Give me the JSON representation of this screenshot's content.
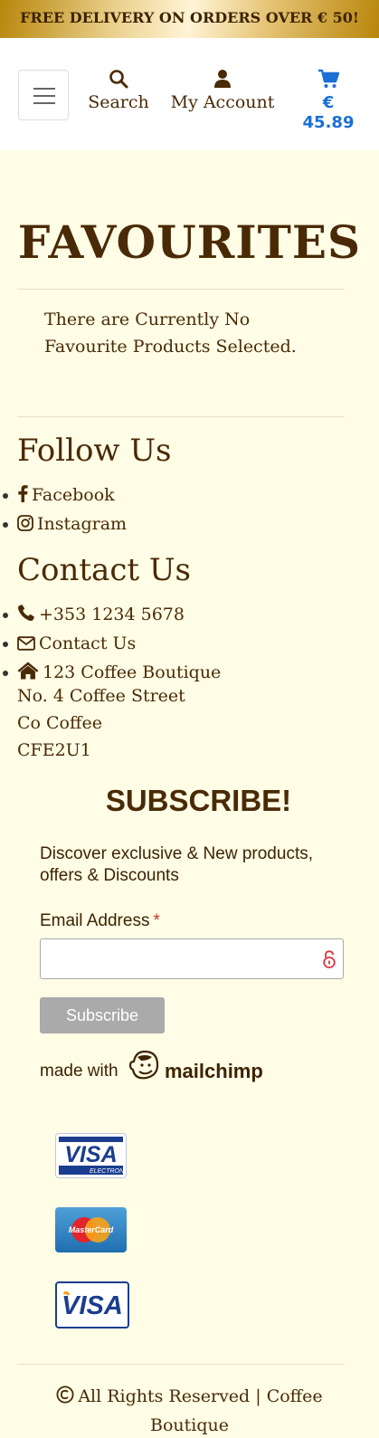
{
  "banner": {
    "text": "FREE DELIVERY ON ORDERS OVER € 50!"
  },
  "header": {
    "menu_icon": "hamburger-menu-icon",
    "search": {
      "icon": "search-icon",
      "label": "Search"
    },
    "account": {
      "icon": "user-icon",
      "label": "My Account"
    },
    "cart": {
      "icon": "shopping-cart-icon",
      "total": "€ 45.89",
      "color": "#1b6fd6"
    }
  },
  "main": {
    "title": "FAVOURITES",
    "empty_message": "There are Currently No Favourite Products Selected."
  },
  "follow": {
    "heading": "Follow Us",
    "items": [
      {
        "icon": "facebook-icon",
        "label": "Facebook"
      },
      {
        "icon": "instagram-icon",
        "label": "Instagram"
      }
    ]
  },
  "contact": {
    "heading": "Contact Us",
    "items": [
      {
        "icon": "phone-icon",
        "label": "+353 1234 5678"
      },
      {
        "icon": "envelope-icon",
        "label": "Contact Us"
      },
      {
        "icon": "home-icon",
        "label": "123 Coffee Boutique"
      }
    ],
    "address_lines": [
      "No. 4 Coffee Street",
      "Co Coffee",
      "CFE2U1"
    ]
  },
  "subscribe": {
    "title": "SUBSCRIBE!",
    "text": "Discover exclusive & New products, offers & Discounts",
    "email_label": "Email Address",
    "required_marker": "*",
    "email_value": "",
    "button_label": "Subscribe",
    "made_with": "made with",
    "brand": "mailchimp"
  },
  "payments": [
    {
      "icon": "visa-electron-card-icon",
      "label": "VISA",
      "sub": "ELECTRON"
    },
    {
      "icon": "mastercard-card-icon",
      "label": "MasterCard"
    },
    {
      "icon": "visa-card-icon",
      "label": "VISA"
    }
  ],
  "footer": {
    "icon": "copyright-icon",
    "text": "All Rights Reserved | Coffee Boutique"
  }
}
